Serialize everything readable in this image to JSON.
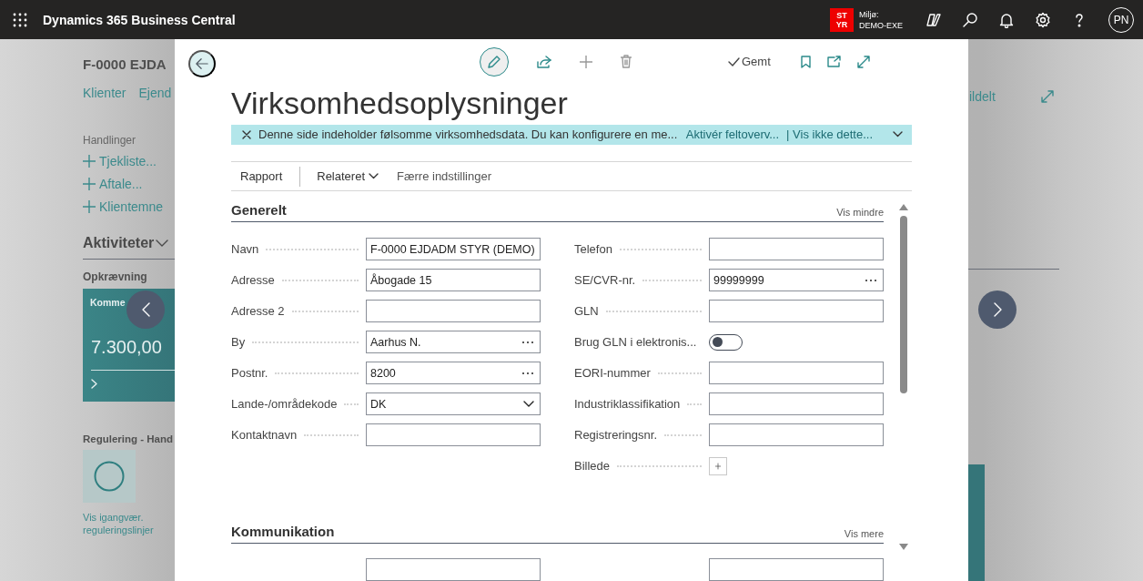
{
  "topbar": {
    "app_title": "Dynamics 365 Business Central",
    "env_badge": [
      "ST",
      "YR"
    ],
    "env_label": "Miljø:",
    "env_name": "DEMO-EXE",
    "user_initials": "PN"
  },
  "background_page": {
    "title": "F-0000 EJDA",
    "nav": [
      "Klienter",
      "Ejend"
    ],
    "nav_right": "ildelt",
    "actions_heading": "Handlinger",
    "actions": [
      "Tjekliste...",
      "Aftale...",
      "Klientemne"
    ],
    "activities_title": "Aktiviteter",
    "group_1": "Opkrævning",
    "tile": {
      "title": "Komme",
      "value": "7.300,00"
    },
    "group_2": "Regulering - Hand",
    "link_tile": "Vis igangvær. reguleringslinjer"
  },
  "dialog": {
    "title": "Virksomhedsoplysninger",
    "saved_status": "Gemt",
    "notification": {
      "message": "Denne side indeholder følsomme virksomhedsdata. Du kan konfigurere en me...",
      "actions": [
        "Aktivér feltoverv...",
        "| Vis ikke dette..."
      ]
    },
    "action_bar": [
      {
        "label": "Rapport",
        "kind": "plain"
      },
      {
        "label": "Relateret",
        "kind": "menu"
      },
      {
        "label": "Færre indstillinger",
        "kind": "muted"
      }
    ],
    "sections": [
      {
        "title": "Generelt",
        "toggle": "Vis mindre",
        "left_fields": [
          {
            "label": "Navn",
            "kind": "text",
            "value": "F-0000 EJDADM STYR (DEMO)"
          },
          {
            "label": "Adresse",
            "kind": "text",
            "value": "Åbogade 15"
          },
          {
            "label": "Adresse 2",
            "kind": "text"
          },
          {
            "label": "By",
            "kind": "lookup",
            "value": "Aarhus N."
          },
          {
            "label": "Postnr.",
            "kind": "lookup",
            "value": "8200"
          },
          {
            "label": "Lande-/områdekode",
            "kind": "dropdown",
            "value": "DK"
          },
          {
            "label": "Kontaktnavn",
            "kind": "text"
          }
        ],
        "right_fields": [
          {
            "label": "Telefon",
            "kind": "text"
          },
          {
            "label": "SE/CVR-nr.",
            "kind": "lookup",
            "value": "99999999"
          },
          {
            "label": "GLN",
            "kind": "text"
          },
          {
            "label": "Brug GLN i elektronis...",
            "kind": "toggle",
            "on": false
          },
          {
            "label": "EORI-nummer",
            "kind": "text"
          },
          {
            "label": "Industriklassifikation",
            "kind": "text"
          },
          {
            "label": "Registreringsnr.",
            "kind": "text"
          },
          {
            "label": "Billede",
            "kind": "image"
          }
        ]
      },
      {
        "title": "Kommunikation",
        "toggle": "Vis mere",
        "left_fields": [
          {
            "kind": "text"
          }
        ],
        "right_fields": [
          {
            "kind": "text"
          }
        ]
      }
    ]
  }
}
